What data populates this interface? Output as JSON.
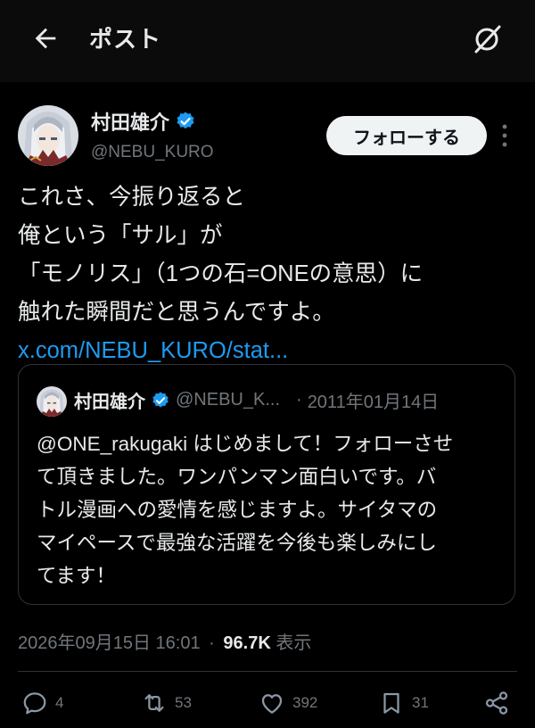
{
  "header": {
    "title": "ポスト",
    "back_icon": "arrow-left-icon",
    "grok_icon": "grok-icon"
  },
  "author": {
    "name": "村田雄介",
    "handle": "@NEBU_KURO",
    "verified": true,
    "verified_color": "#1d9bf0",
    "avatar": "avatar-illustration"
  },
  "follow_button": {
    "label": "フォローする"
  },
  "post": {
    "lines": [
      "これさ、今振り返ると",
      "俺という「サル」が",
      "「モノリス」（1つの石=ONEの意思）に",
      "触れた瞬間だと思うんですよ。"
    ],
    "link_text": "x.com/NEBU_KURO/stat...",
    "link_color": "#1d9bf0"
  },
  "quote": {
    "name": "村田雄介",
    "handle": "@NEBU_K...",
    "dot": "·",
    "date": "2011年01月14日",
    "lines": [
      "@ONE_rakugaki はじめまして！フォローさせ",
      "て頂きました。ワンパンマン面白いです。バ",
      "トル漫画への愛情を感じますよ。サイタマの",
      "マイペースで最強な活躍を今後も楽しみにし",
      "てます！"
    ]
  },
  "meta": {
    "timestamp": "2026年09月15日 16:01",
    "separator": "·",
    "views_count": "96.7K",
    "views_label": "表示"
  },
  "actions": {
    "replies": "4",
    "reposts": "53",
    "likes": "392",
    "bookmarks": "31"
  }
}
